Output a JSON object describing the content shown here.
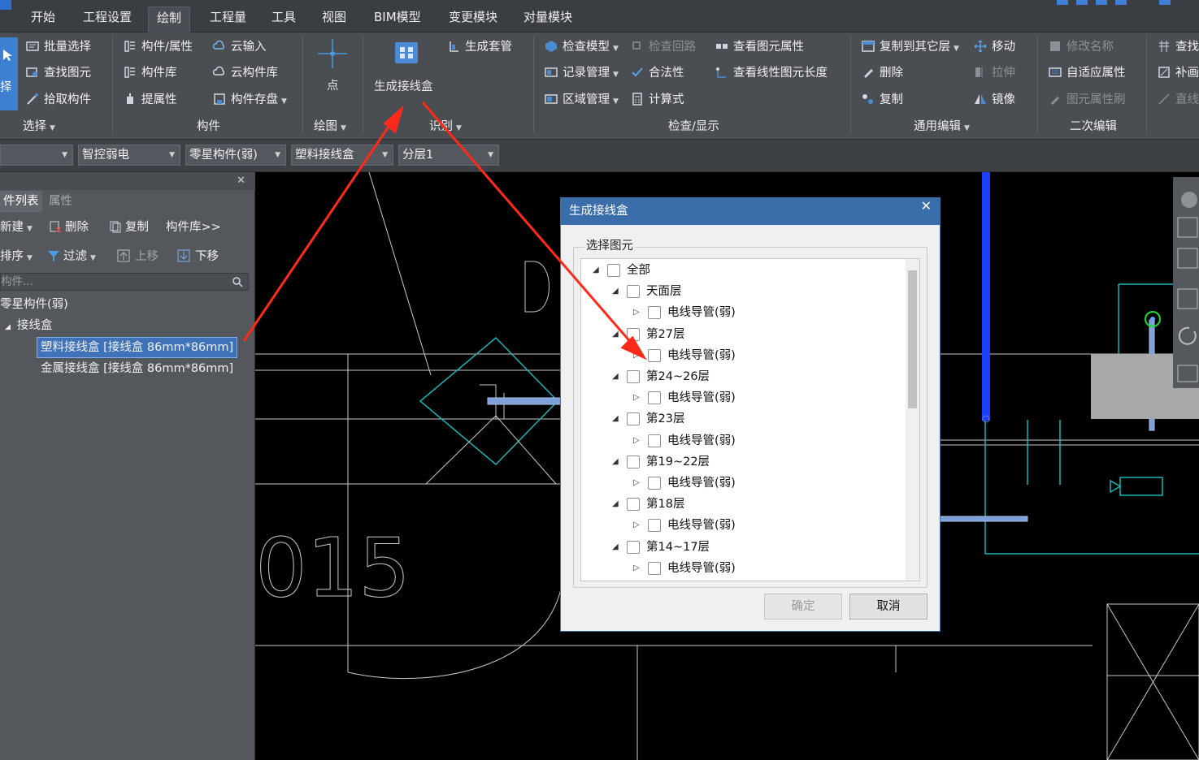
{
  "menu": {
    "items": [
      "开始",
      "工程设置",
      "绘制",
      "工程量",
      "工具",
      "视图",
      "BIM模型",
      "变更模块",
      "对量模块"
    ],
    "active": "绘制"
  },
  "ribbon": {
    "select": {
      "partial": "择",
      "batch_select": "批量选择",
      "find_element": "查找图元",
      "pick_component": "拾取构件",
      "group": "选择"
    },
    "component": {
      "comp_attr": "构件/属性",
      "comp_lib": "构件库",
      "extract_attr": "提属性",
      "cloud_input": "云输入",
      "cloud_lib": "云构件库",
      "comp_save": "构件存盘",
      "group": "构件"
    },
    "draw": {
      "point": "点",
      "group": "绘图"
    },
    "identify": {
      "gen_junction_box": "生成接线盒",
      "gen_sleeve": "生成套管",
      "group": "识别"
    },
    "check": {
      "check_model": "检查模型",
      "record_mgmt": "记录管理",
      "area_mgmt": "区域管理",
      "check_loop": "检查回路",
      "legality": "合法性",
      "formula": "计算式",
      "view_attr": "查看图元属性",
      "view_length": "查看线性图元长度",
      "group": "检查/显示"
    },
    "edit": {
      "copy_to_floor": "复制到其它层",
      "move": "移动",
      "delete": "删除",
      "stretch": "拉伸",
      "copy": "复制",
      "mirror": "镜像",
      "group": "通用编辑"
    },
    "secondary": {
      "rename": "修改名称",
      "adaptive_attr": "自适应属性",
      "attr_brush": "图元属性刷",
      "group": "二次编辑"
    },
    "extra": {
      "find": "查找",
      "supplement": "补画",
      "straight": "直线"
    }
  },
  "toolbar": {
    "combos": [
      "",
      "智控弱电",
      "零星构件(弱)",
      "塑料接线盒",
      "分层1"
    ]
  },
  "leftpanel": {
    "tabs": [
      "件列表",
      "属性"
    ],
    "new": "新建",
    "delete": "删除",
    "copy": "复制",
    "comp_lib": "构件库>>",
    "sort": "排序",
    "filter": "过滤",
    "move_up": "上移",
    "move_down": "下移",
    "search_placeholder": "构件...",
    "tree": {
      "root": "零星构件(弱)",
      "category": "接线盒",
      "items": [
        "塑料接线盒 [接线盒 86mm*86mm]",
        "金属接线盒 [接线盒 86mm*86mm]"
      ]
    }
  },
  "canvas": {
    "label_015": "015",
    "label_d": "D"
  },
  "dialog": {
    "title": "生成接线盒",
    "legend": "选择图元",
    "tree": [
      {
        "label": "全部",
        "level": 0,
        "expanded": true
      },
      {
        "label": "天面层",
        "level": 1,
        "expanded": true
      },
      {
        "label": "电线导管(弱)",
        "level": 2,
        "expanded": false
      },
      {
        "label": "第27层",
        "level": 1,
        "expanded": true
      },
      {
        "label": "电线导管(弱)",
        "level": 2,
        "expanded": false
      },
      {
        "label": "第24~26层",
        "level": 1,
        "expanded": true
      },
      {
        "label": "电线导管(弱)",
        "level": 2,
        "expanded": false
      },
      {
        "label": "第23层",
        "level": 1,
        "expanded": true
      },
      {
        "label": "电线导管(弱)",
        "level": 2,
        "expanded": false
      },
      {
        "label": "第19~22层",
        "level": 1,
        "expanded": true
      },
      {
        "label": "电线导管(弱)",
        "level": 2,
        "expanded": false
      },
      {
        "label": "第18层",
        "level": 1,
        "expanded": true
      },
      {
        "label": "电线导管(弱)",
        "level": 2,
        "expanded": false
      },
      {
        "label": "第14~17层",
        "level": 1,
        "expanded": true
      },
      {
        "label": "电线导管(弱)",
        "level": 2,
        "expanded": false
      }
    ],
    "ok": "确定",
    "cancel": "取消"
  },
  "colors": {
    "accent": "#3a6eab",
    "annotation_arrow": "#ff2a1a",
    "cad_cyan": "#00c8c8",
    "cad_blue": "#1f3fff"
  }
}
